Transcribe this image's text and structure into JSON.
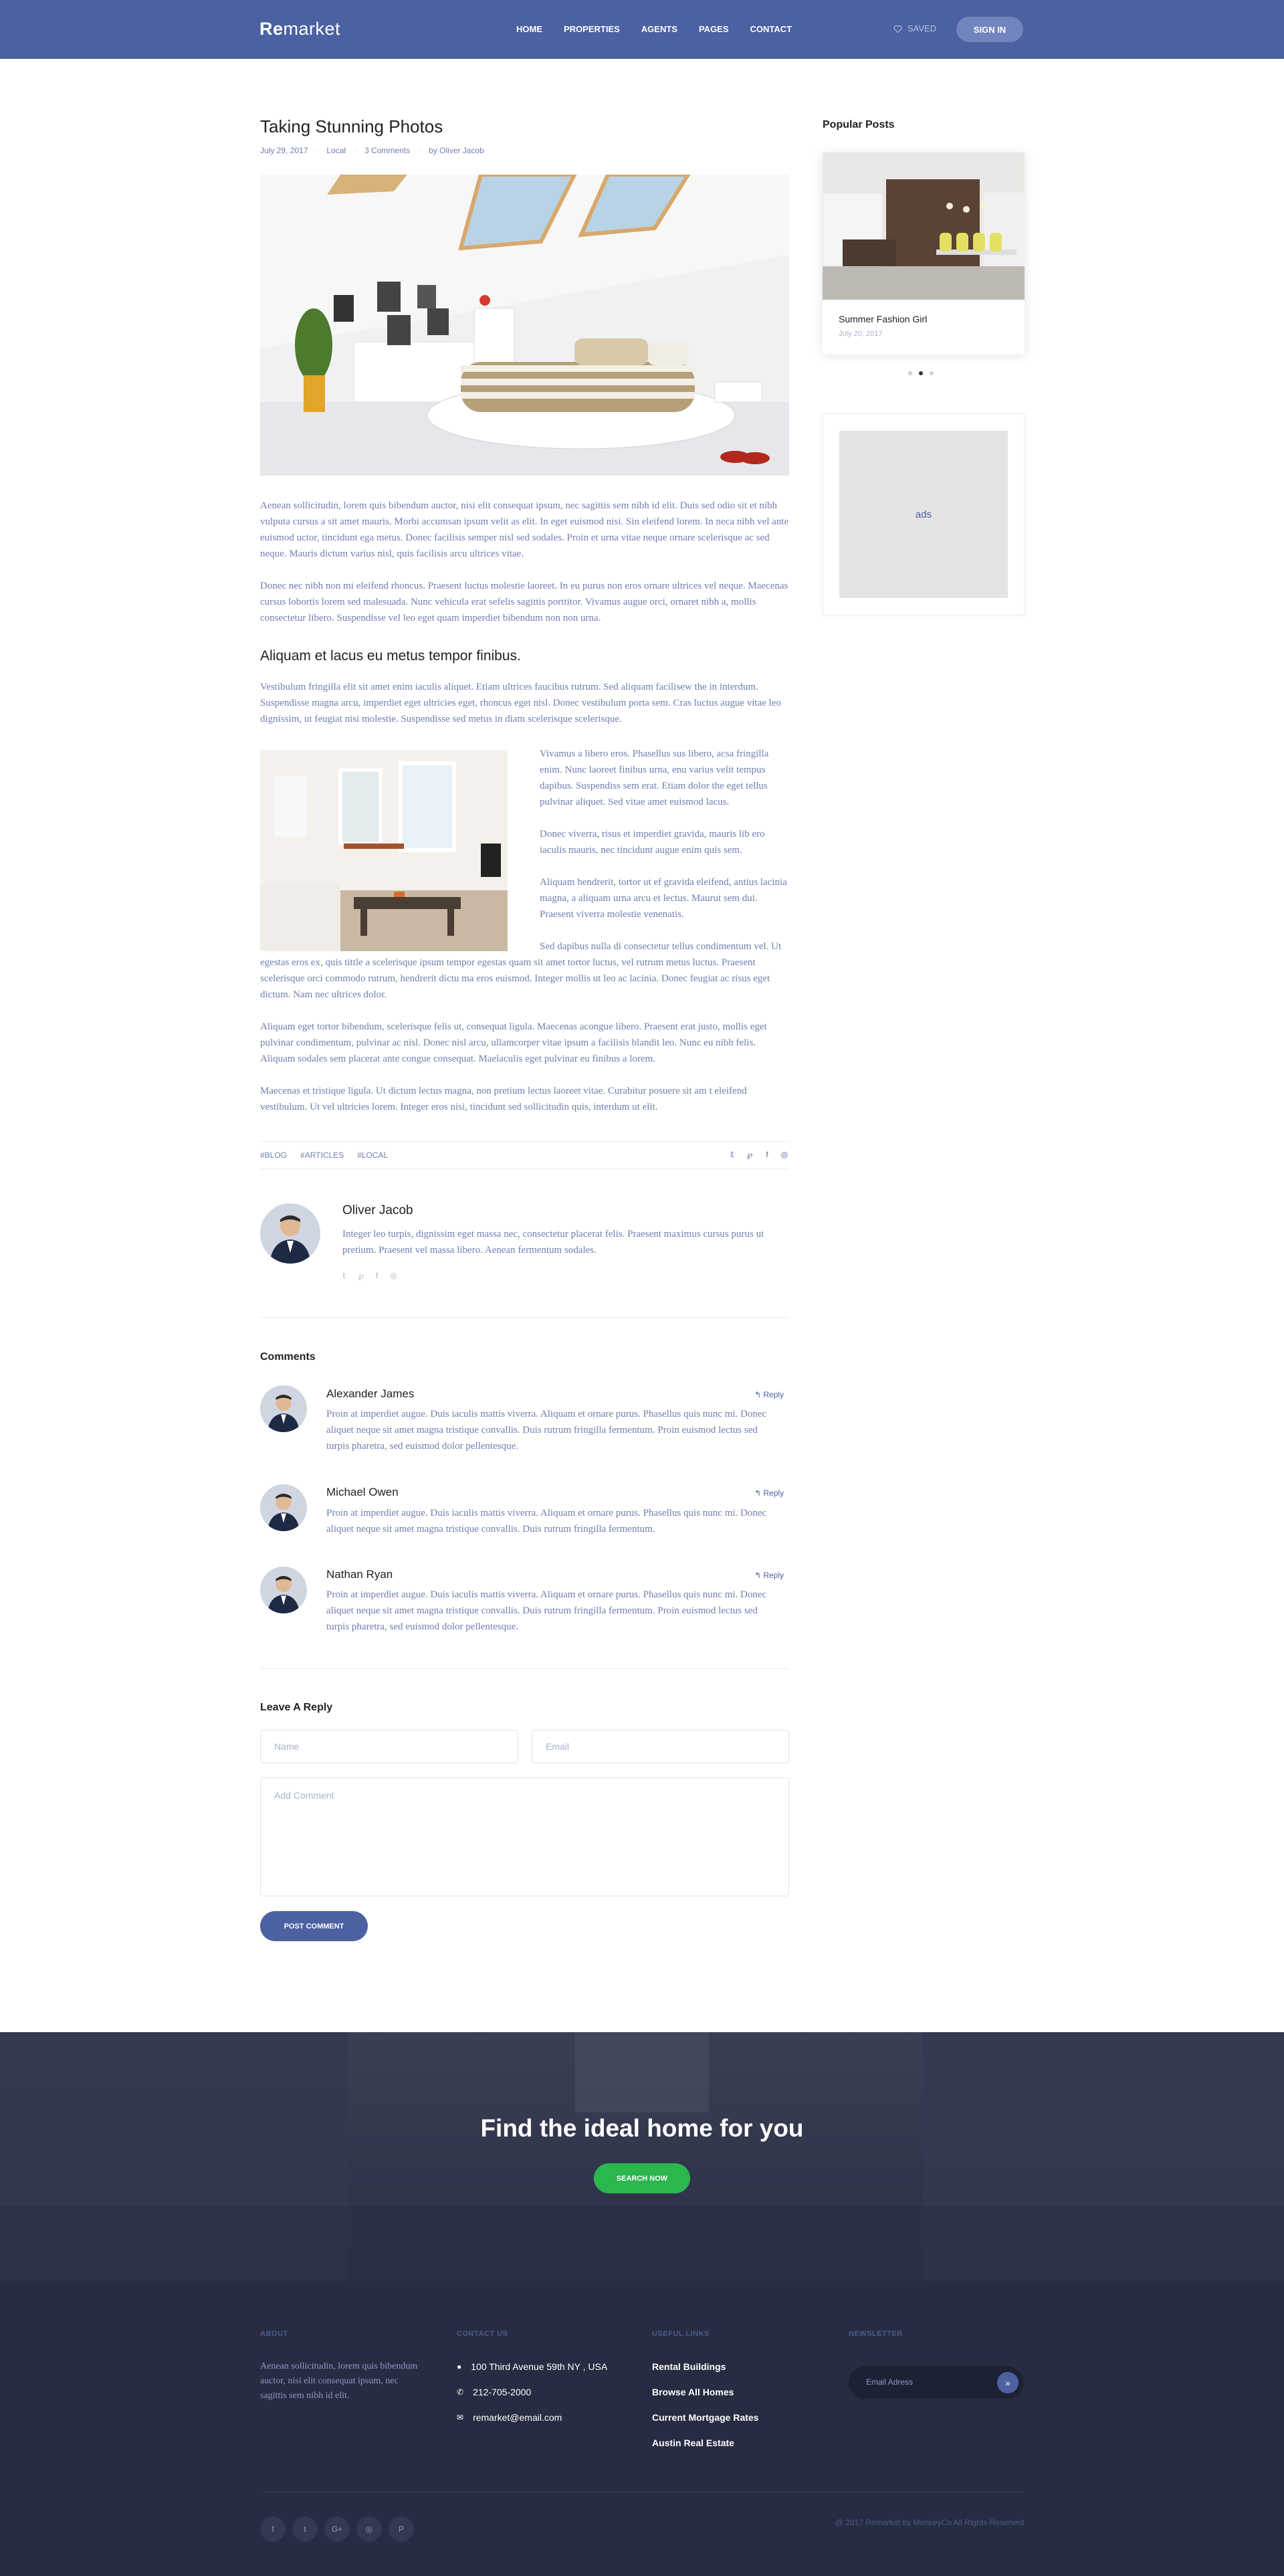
{
  "header": {
    "logo_bold": "Re",
    "logo_rest": "market",
    "nav": [
      "HOME",
      "PROPERTIES",
      "AGENTS",
      "PAGES",
      "CONTACT"
    ],
    "saved_label": "SAVED",
    "signin_label": "SIGN IN"
  },
  "post": {
    "title": "Taking Stunning Photos",
    "meta": {
      "date": "July 29, 2017",
      "category": "Local",
      "comments": "3 Comments",
      "author": "by Oliver Jacob"
    },
    "para1": "Aenean sollicitudin, lorem quis bibendum auctor, nisi elit consequat ipsum, nec sagittis sem nibh id elit. Duis sed odio sit et nibh vulputa cursus a sit amet mauris. Morbi accumsan ipsum velit as elit. In eget euismod nisi. Sin eleifend lorem. In neca nibh vel ante euismod uctor, tincidunt ega metus. Donec facilisis semper nisl sed sodales. Proin et urna vitae neque ornare scelerisque ac sed neque. Mauris dictum varius nisl, quis facilisis arcu ultrices vitae.",
    "para2": "Donec nec nibh non mi eleifend rhoncus. Praesent luctus molestie laoreet. In eu purus non eros ornare ultrices vel neque. Maecenas cursus lobortis lorem sed malesuada. Nunc vehicula erat sefelis sagittis porttitor. Vivamus augue orci, ornaret nibh a, mollis consectetur libero. Suspendisse vel leo eget quam imperdiet bibendum non non urna.",
    "section_heading": "Aliquam et lacus eu metus tempor finibus.",
    "para3": "Vestibulum fringilla elit sit amet enim iaculis aliquet. Etiam ultrices faucibus rutrum. Sed aliquam facilisew the in interdum. Suspendisse magna arcu, imperdiet eget ultricies eget, rhoncus eget nisl. Donec vestibulum porta sem. Cras luctus augue vitae leo dignissim, ut feugiat nisi molestie. Suspendisse sed metus in diam scelerisque scelerisque.",
    "side1": "Vivamus a libero eros. Phasellus sus libero, acsa fringilla enim. Nunc laoreet finibus urna, enu varius velit tempus dapibus. Suspendiss sem erat. Etiam dolor the eget tellus pulvinar aliquet. Sed vitae amet euismod lacus.",
    "side2": "Donec viverra, risus et imperdiet gravida, mauris lib ero iaculis mauris, nec tincidunt augue enim quis sem.",
    "side3": "Aliquam hendrerit, tortor ut ef gravida eleifend, antius lacinia magna, a aliquam urna arcu et lectus. Maurut sem dui. Praesent viverra molestie venenatis.",
    "para4": "Sed dapibus nulla di consectetur tellus condimentum vel. Ut egestas eros ex, quis tittle a scelerisque ipsum tempor egestas quam sit amet tortor luctus, vel rutrum metus luctus. Praesent scelerisque orci commodo rutrum, hendrerit dictu ma eros euismod. Integer mollis ut leo ac lacinia. Donec feugiat ac risus eget dictum. Nam nec ultrices dolor.",
    "para5": "Aliquam eget tortor bibendum, scelerisque felis ut, consequat ligula. Maecenas acongue libero. Praesent erat justo, mollis eget pulvinar condimentum, pulvinar ac nisl. Donec nisl arcu, ullamcorper vitae ipsum a facilisis blandit leo. Nunc eu nibh felis. Aliquam sodales sem placerat ante congue consequat. Maelaculis eget pulvinar eu finibus a lorem.",
    "para6": "Maecenas et tristique ligula. Ut dictum lectus magna, non pretium lectus laoreet vitae. Curabitur posuere sit am t eleifend vestibulum. Ut vel ultricies lorem. Integer eros nisi, tincidunt sed sollicitudin quis, interdum ut elit.",
    "tags": [
      "#BLOG",
      "#ARTICLES",
      "#LOCAL"
    ],
    "share_icons": [
      "twitter-icon",
      "pinterest-icon",
      "facebook-icon",
      "instagram-icon"
    ]
  },
  "author": {
    "name": "Oliver Jacob",
    "bio": "Integer leo turpis, dignissim eget massa nec, consectetur placerat felis. Praesent maximus cursus purus ut pretium. Praesent vel massa libero. Aenean fermentum sodales."
  },
  "comments": {
    "heading": "Comments",
    "reply_label": "Reply",
    "items": [
      {
        "name": "Alexander James",
        "text": "Proin at imperdiet augue. Duis iaculis mattis viverra. Aliquam et ornare purus. Phasellus quis nunc mi. Donec aliquet neque sit amet magna tristique convallis. Duis rutrum fringilla fermentum. Proin euismod lectus sed turpis pharetra, sed euismod dolor pellentesque."
      },
      {
        "name": "Michael Owen",
        "text": "Proin at imperdiet augue. Duis iaculis mattis viverra. Aliquam et ornare purus. Phasellus quis nunc mi. Donec aliquet neque sit amet magna tristique convallis. Duis rutrum fringilla fermentum."
      },
      {
        "name": "Nathan Ryan",
        "text": "Proin at imperdiet augue. Duis iaculis mattis viverra. Aliquam et ornare purus. Phasellus quis nunc mi. Donec aliquet neque sit amet magna tristique convallis. Duis rutrum fringilla fermentum. Proin euismod lectus sed turpis pharetra, sed euismod dolor pellentesque."
      }
    ]
  },
  "reply_form": {
    "heading": "Leave A Reply",
    "name_placeholder": "Name",
    "email_placeholder": "Email",
    "comment_placeholder": "Add Comment",
    "submit_label": "POST COMMENT"
  },
  "sidebar": {
    "popular_heading": "Popular Posts",
    "popular_title": "Summer Fashion Girl",
    "popular_date": "July 20, 2017",
    "ads_label": "ads"
  },
  "cta": {
    "title": "Find the ideal home for you",
    "button_label": "SEARCH NOW"
  },
  "footer": {
    "about_heading": "ABOUT",
    "about_text": "Aenean sollicitudin, lorem quis bibendum auctor, nisi elit consequat ipsum, nec sagittis sem nibh id elit.",
    "contact_heading": "CONTACT US",
    "address": "100 Third Avenue 59th NY , USA",
    "phone": "212-705-2000",
    "email": "remarket@email.com",
    "links_heading": "USEFUL LINKS",
    "links": [
      "Rental Buildings",
      "Browse All Homes",
      "Current Mortgage Rates",
      "Austin Real Estate"
    ],
    "newsletter_heading": "NEWSLETTER",
    "newsletter_placeholder": "Email Adress",
    "social": [
      "f",
      "t",
      "G+",
      "◎",
      "P"
    ],
    "copyright": "@ 2017 Remarket by MonkeyCo All Rights Reserved"
  },
  "colors": {
    "brand": "#4b61a1",
    "cta_green": "#2bb64e",
    "footer_bg": "#272c42",
    "body_text": "#6f7fae"
  }
}
